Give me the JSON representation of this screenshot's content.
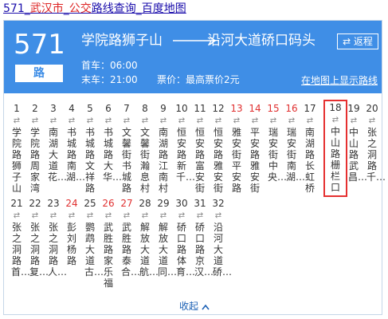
{
  "page": {
    "title_parts": [
      "571",
      "_",
      "武汉市",
      "_",
      "公交",
      "路线查询",
      "_",
      "百度地图"
    ]
  },
  "route": {
    "number": "571",
    "suffix": "路",
    "from": "学院路狮子山",
    "to": "沿河大道硚口码头",
    "return_label": "⇄ 返程",
    "first_bus": "首车：06:00",
    "last_bus": "末车：21:00",
    "fare": "票价：最高票价2元",
    "map_link": "在地图上显示路线"
  },
  "stops": [
    {
      "num": "1",
      "name": "学院路狮子山",
      "short": "学院路狮子山",
      "red": false
    },
    {
      "num": "2",
      "name": "学院路周家湾",
      "short": "学院路周家湾",
      "red": false
    },
    {
      "num": "3",
      "name": "南湖大道花…",
      "short": "南湖大道花…",
      "red": false
    },
    {
      "num": "4",
      "name": "书城路南湖…",
      "short": "书城路南湖…",
      "red": false
    },
    {
      "num": "5",
      "name": "书城路文祥路",
      "short": "书城路文祥路",
      "red": false
    },
    {
      "num": "6",
      "name": "书城路大华…",
      "short": "书城路大华…",
      "red": false
    },
    {
      "num": "7",
      "name": "文馨街书城路",
      "short": "文馨街书城路",
      "red": false
    },
    {
      "num": "8",
      "name": "文馨街瀚息村",
      "short": "文馨街瀚息村",
      "red": false
    },
    {
      "num": "9",
      "name": "南湖路江南村",
      "short": "南湖路江南村",
      "red": false
    },
    {
      "num": "10",
      "name": "恒安路新千…",
      "short": "恒安路新千…",
      "red": false
    },
    {
      "num": "11",
      "name": "恒安路富安街",
      "short": "恒安路富安街",
      "red": false
    },
    {
      "num": "12",
      "name": "恒安路雅安街",
      "short": "恒安路雅安街",
      "red": false
    },
    {
      "num": "13",
      "name": "雅安街平安路",
      "short": "雅安街平安路",
      "red": true
    },
    {
      "num": "14",
      "name": "平安路雅安街",
      "short": "平安路雅安街",
      "red": true
    },
    {
      "num": "15",
      "name": "瑞安街中央…",
      "short": "瑞安街中央…",
      "red": true
    },
    {
      "num": "16",
      "name": "瑞安街南湖…",
      "short": "瑞安街南湖…",
      "red": true
    },
    {
      "num": "17",
      "name": "南湖路长虹桥",
      "short": "南湖路长虹桥",
      "red": false
    },
    {
      "num": "18",
      "name": "中山路栅栏口",
      "short": "中山路栅栏口",
      "red": false,
      "selected": true
    },
    {
      "num": "19",
      "name": "中山路武昌…",
      "short": "中山路武昌…",
      "red": false
    },
    {
      "num": "20",
      "name": "张之洞路千…",
      "short": "张之洞路千…",
      "red": false
    },
    {
      "num": "21",
      "name": "张之洞路首…",
      "short": "张之洞路首…",
      "red": false
    },
    {
      "num": "22",
      "name": "张之洞路复…",
      "short": "张之洞路复…",
      "red": false
    },
    {
      "num": "23",
      "name": "张之洞路人…",
      "short": "张之洞路人…",
      "red": false
    },
    {
      "num": "24",
      "name": "彭刘杨路",
      "short": "彭刘杨路",
      "red": true
    },
    {
      "num": "25",
      "name": "鹦鹉大道古…",
      "short": "鹦鹉大道古…",
      "red": false
    },
    {
      "num": "26",
      "name": "武胜路家乐福",
      "short": "武胜路家乐福",
      "red": true
    },
    {
      "num": "27",
      "name": "武胜路泰合…",
      "short": "武胜路泰合…",
      "red": true
    },
    {
      "num": "28",
      "name": "解放大道航…",
      "short": "解放大道航…",
      "red": false
    },
    {
      "num": "29",
      "name": "解放大道同…",
      "short": "解放大道同…",
      "red": false
    },
    {
      "num": "30",
      "name": "硚口路体育…",
      "short": "硚口路体育…",
      "red": false
    },
    {
      "num": "31",
      "name": "硚口路京汉…",
      "short": "硚口路京汉…",
      "red": false
    },
    {
      "num": "32",
      "name": "沿河大道硚…",
      "short": "沿河大道硚…",
      "red": false
    }
  ],
  "collapse_label": "收起",
  "colors": {
    "header_bg": "#3f8ee6",
    "highlight_red": "#e03030",
    "link_blue": "#1a0dab"
  }
}
